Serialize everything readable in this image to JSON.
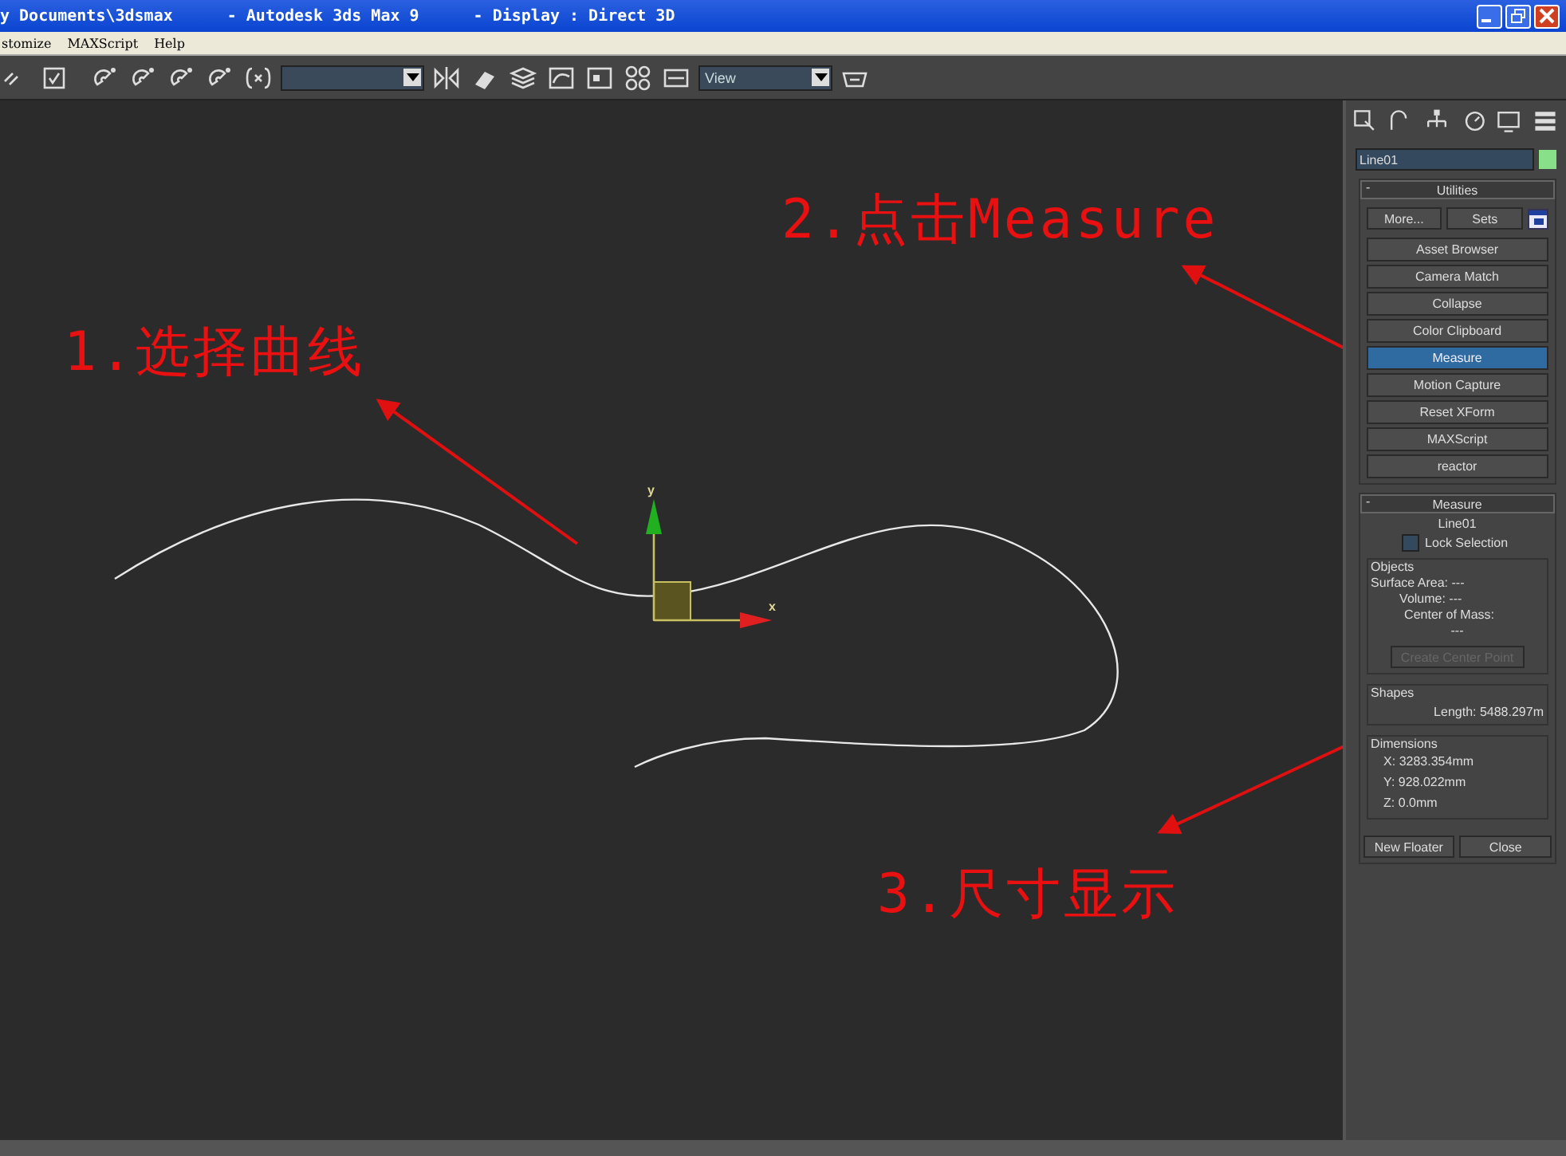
{
  "window": {
    "title_parts": [
      "y Documents\\3dsmax",
      "- Autodesk 3ds Max 9",
      "- Display : Direct 3D"
    ]
  },
  "menu": [
    "stomize",
    "MAXScript",
    "Help"
  ],
  "toolbar": {
    "view_dropdown": {
      "value": "View"
    }
  },
  "command_panel": {
    "object_name": "Line01",
    "utilities": {
      "title": "Utilities",
      "collapse": "-",
      "more": "More...",
      "sets": "Sets",
      "buttons": [
        {
          "label": "Asset Browser",
          "selected": false
        },
        {
          "label": "Camera Match",
          "selected": false
        },
        {
          "label": "Collapse",
          "selected": false
        },
        {
          "label": "Color Clipboard",
          "selected": false
        },
        {
          "label": "Measure",
          "selected": true
        },
        {
          "label": "Motion Capture",
          "selected": false
        },
        {
          "label": "Reset XForm",
          "selected": false
        },
        {
          "label": "MAXScript",
          "selected": false
        },
        {
          "label": "reactor",
          "selected": false
        }
      ]
    },
    "measure": {
      "title": "Measure",
      "collapse": "-",
      "object": "Line01",
      "lock_selection": {
        "label": "Lock Selection",
        "checked": false
      },
      "objects": {
        "title": "Objects",
        "surface_area": "Surface Area: ---",
        "volume": "Volume: ---",
        "center_of_mass": "Center of Mass:",
        "center_value": "---",
        "create_button": {
          "label": "Create Center Point",
          "disabled": true
        }
      },
      "shapes": {
        "title": "Shapes",
        "length": "Length: 5488.297m"
      },
      "dimensions": {
        "title": "Dimensions",
        "rows": [
          "X:  3283.354mm",
          "Y:  928.022mm",
          "Z:  0.0mm"
        ]
      },
      "new_floater": "New Floater",
      "close": "Close"
    }
  },
  "viewport": {
    "gizmo": {
      "x_label": "x",
      "y_label": "y"
    },
    "annotations": [
      {
        "text": "1.选择曲线"
      },
      {
        "text": "2.点击Measure"
      },
      {
        "text": "3.尺寸显示"
      }
    ]
  }
}
